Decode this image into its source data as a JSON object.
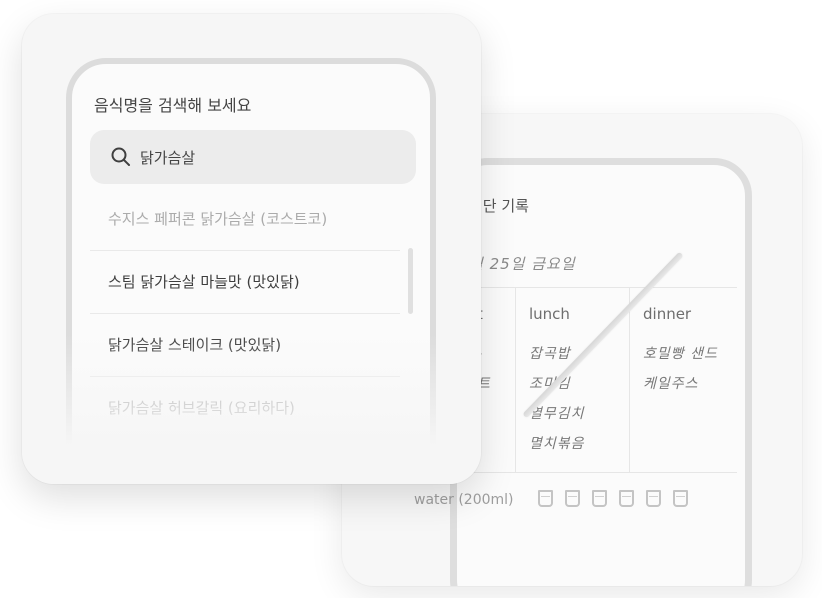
{
  "record": {
    "title": "식단 기록",
    "date": "월 25일 금요일",
    "meals": [
      {
        "head": "t",
        "items": [
          "-",
          "트"
        ]
      },
      {
        "head": "lunch",
        "items": [
          "잡곡밥",
          "조미김",
          "열무김치",
          "멸치볶음"
        ]
      },
      {
        "head": "dinner",
        "items": [
          "호밀빵 샌드",
          "케일주스"
        ]
      }
    ],
    "water_label": "water (200ml)",
    "cup_icon": "water-cup-icon",
    "cup_count": 6
  },
  "search": {
    "prompt": "음식명을 검색해 보세요",
    "query": "닭가슴살",
    "results": [
      "수지스 페퍼콘 닭가슴살 (코스트코)",
      "스팀 닭가슴살 마늘맛 (맛있닭)",
      "닭가슴살 스테이크 (맛있닭)",
      "닭가슴살 허브갈릭 (요리하다)"
    ]
  },
  "colors": {
    "card_background": "#f6f6f6",
    "phone_frame": "#dcdcdc",
    "search_field": "#ececec"
  }
}
